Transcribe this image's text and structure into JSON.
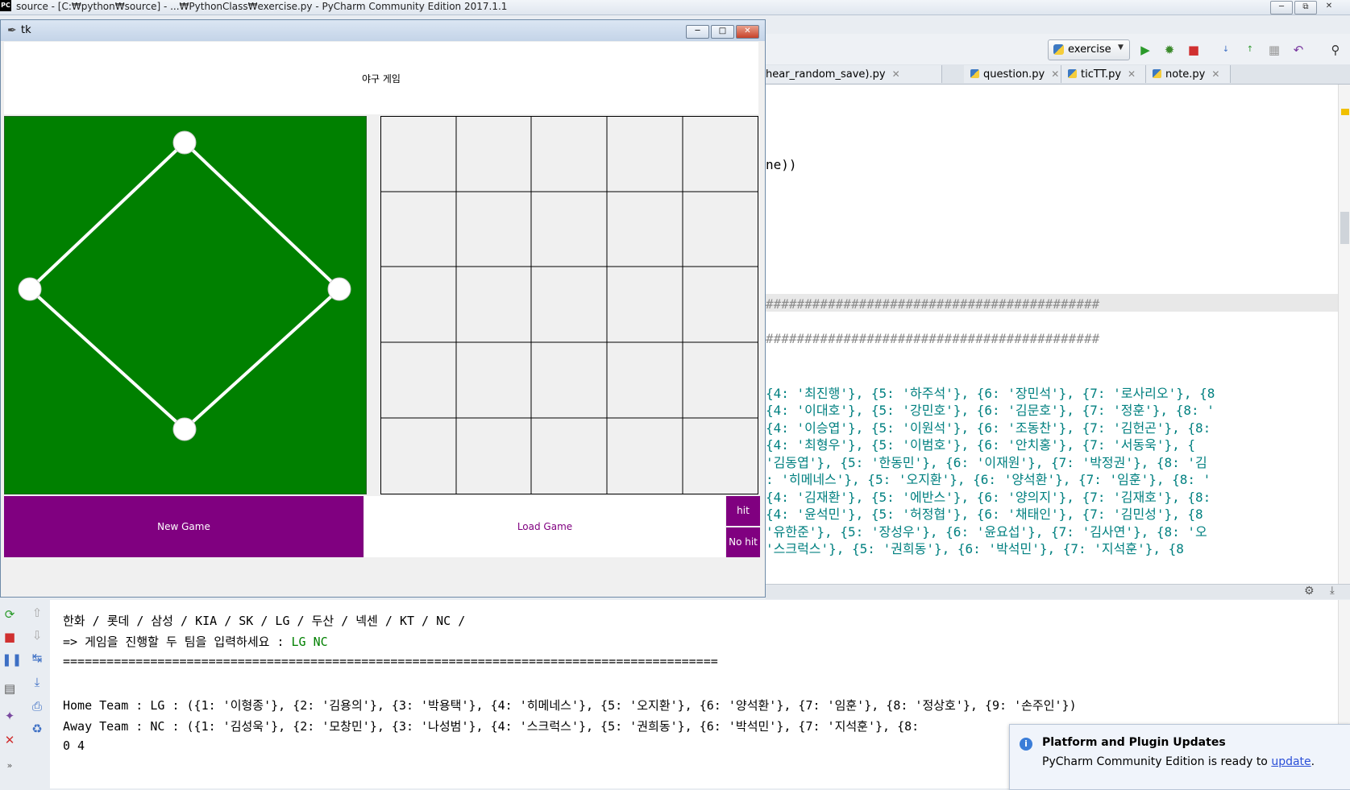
{
  "ide": {
    "window_title": "source - [C:₩python₩source] - ...₩PythonClass₩exercise.py - PyCharm Community Edition 2017.1.1",
    "logo": "PC",
    "run_config": "exercise",
    "tabs": [
      {
        "label": "hear_random_save).py"
      },
      {
        "label": "question.py"
      },
      {
        "label": "ticTT.py"
      },
      {
        "label": "note.py"
      }
    ],
    "editor_lines": [
      "ne))",
      "###########################################",
      "###########################################",
      "{4: '최진행'}, {5: '하주석'}, {6: '장민석'}, {7: '로사리오'}, {8",
      "{4: '이대호'}, {5: '강민호'}, {6: '김문호'}, {7: '정훈'}, {8: '",
      "{4: '이승엽'}, {5: '이원석'}, {6: '조동찬'}, {7: '김헌곤'}, {8:",
      " {4: '최형우'}, {5: '이범호'}, {6: '안치홍'}, {7: '서동욱'}, {",
      "'김동엽'}, {5: '한동민'}, {6: '이재원'}, {7: '박정권'}, {8: '김",
      ": '히메네스'}, {5: '오지환'}, {6: '양석환'}, {7: '임훈'}, {8: '",
      "{4: '김재환'}, {5: '에반스'}, {6: '양의지'}, {7: '김재호'}, {8:",
      "{4: '윤석민'}, {5: '허정협'}, {6: '채태인'}, {7: '김민성'}, {8",
      "'유한준'}, {5: '장성우'}, {6: '윤요섭'}, {7: '김사연'}, {8: '오",
      "'스크럭스'}, {5: '권희동'}, {6: '박석민'}, {7: '지석훈'}, {8"
    ]
  },
  "tk": {
    "window_title": "tk",
    "game_title": "야구 게임",
    "buttons": {
      "new_game": "New Game",
      "load_game": "Load Game",
      "hit": "hit",
      "no_hit": "No hit"
    },
    "colors": {
      "field": "#008000",
      "button": "#800080"
    }
  },
  "console": {
    "teams_line": "한화 /  롯데 /  삼성 /  KIA /  SK /  LG /  두산 /  넥센 /  KT /  NC /",
    "prompt": "=> 게임을 진행할 두 팀을 입력하세요 : ",
    "input": "LG NC",
    "separator": "==========================================================================================",
    "home_team": "Home Team : LG :  ({1: '이형종'}, {2: '김용의'}, {3: '박용택'}, {4: '히메네스'}, {5: '오지환'}, {6: '양석환'}, {7: '임훈'}, {8: '정상호'}, {9: '손주인'})",
    "away_team": "Away Team : NC :  ({1: '김성욱'}, {2: '모창민'}, {3: '나성범'}, {4: '스크럭스'}, {5: '권희동'}, {6: '박석민'}, {7: '지석훈'}, {8:",
    "score": "0 4"
  },
  "notification": {
    "title": "Platform and Plugin Updates",
    "body": "PyCharm Community Edition is ready to ",
    "link": "update",
    "tail": "."
  }
}
